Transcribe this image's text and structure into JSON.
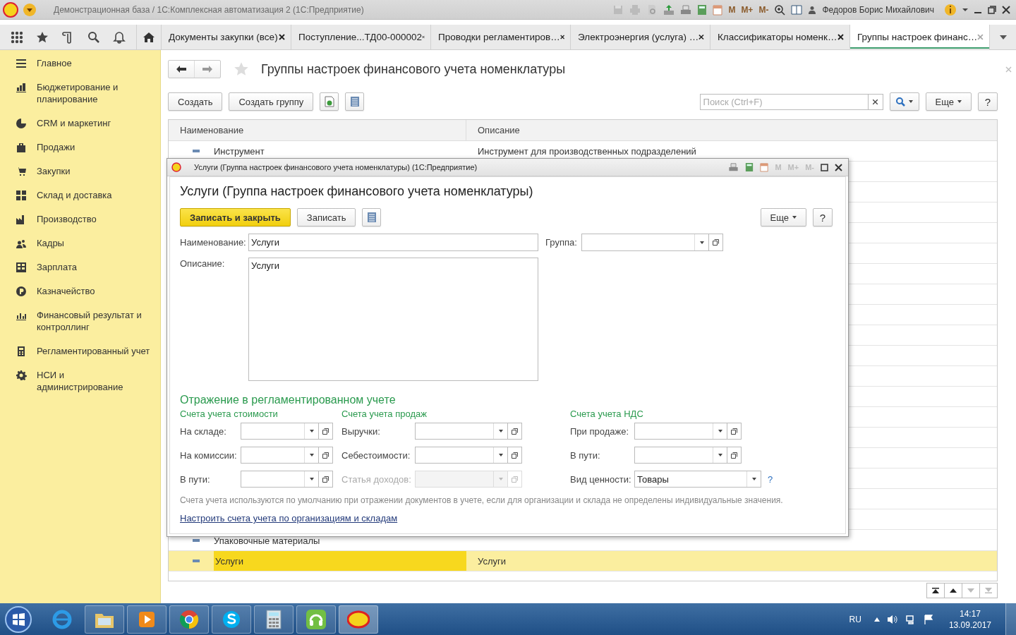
{
  "window": {
    "title": "Демонстрационная база / 1С:Комплексная автоматизация 2  (1С:Предприятие)",
    "memory_buttons": [
      "M",
      "M+",
      "M-"
    ],
    "user": "Федоров Борис Михайлович"
  },
  "tabs": [
    {
      "label": "Документы закупки (все)",
      "selected": false
    },
    {
      "label": "Поступление...ТД00-000002",
      "selected": false
    },
    {
      "label": "Проводки регламентиров…",
      "selected": false
    },
    {
      "label": "Электроэнергия (услуга) …",
      "selected": false
    },
    {
      "label": "Классификаторы номенк…",
      "selected": false
    },
    {
      "label": "Группы настроек финанс…",
      "selected": true
    }
  ],
  "sidebar": {
    "items": [
      "Главное",
      "Бюджетирование и планирование",
      "CRM и маркетинг",
      "Продажи",
      "Закупки",
      "Склад и доставка",
      "Производство",
      "Кадры",
      "Зарплата",
      "Казначейство",
      "Финансовый результат и контроллинг",
      "Регламентированный учет",
      "НСИ и администрирование"
    ]
  },
  "page": {
    "title": "Группы настроек финансового учета номенклатуры",
    "buttons": [
      "Создать",
      "Создать группу"
    ],
    "search": {
      "placeholder": "Поиск (Ctrl+F)"
    },
    "more": "Еще",
    "help": "?"
  },
  "table": {
    "columns": [
      "Наименование",
      "Описание"
    ],
    "rows": [
      {
        "name": "Инструмент",
        "description": "Инструмент для производственных подразделений",
        "selected": false
      },
      {
        "name": "Упаковочные материалы",
        "description": "",
        "selected": false
      },
      {
        "name": "Услуги",
        "description": "Услуги",
        "selected": true
      }
    ]
  },
  "dialog": {
    "window_title": "Услуги (Группа настроек финансового учета номенклатуры)  (1С:Предприятие)",
    "memory_buttons": [
      "M",
      "M+",
      "M-"
    ],
    "heading": "Услуги (Группа настроек финансового учета номенклатуры)",
    "primary_button": "Записать и закрыть",
    "save_button": "Записать",
    "more": "Еще",
    "help": "?",
    "name_label": "Наименование:",
    "name_value": "Услуги",
    "group_label": "Группа:",
    "description_label": "Описание:",
    "description_value": "Услуги",
    "section_title": "Отражение в регламентированном учете",
    "columns": [
      {
        "header": "Счета учета стоимости",
        "fields": [
          {
            "label": "На складе:",
            "disabled": false
          },
          {
            "label": "На комиссии:",
            "disabled": false
          },
          {
            "label": "В пути:",
            "disabled": false
          }
        ]
      },
      {
        "header": "Счета учета продаж",
        "fields": [
          {
            "label": "Выручки:",
            "disabled": false
          },
          {
            "label": "Себестоимости:",
            "disabled": false
          },
          {
            "label": "Статья доходов:",
            "disabled": true
          }
        ]
      },
      {
        "header": "Счета учета НДС",
        "fields": [
          {
            "label": "При продаже:",
            "disabled": false
          },
          {
            "label": "В пути:",
            "disabled": false
          },
          {
            "label": "Вид ценности:",
            "value": "Товары",
            "help": "?",
            "disabled": false
          }
        ]
      }
    ],
    "note": "Счета учета используются по умолчанию при отражении документов в учете, если для организации и склада не определены индивидуальные значения.",
    "link": "Настроить счета учета по организациям и складам"
  },
  "taskbar": {
    "language": "RU",
    "time": "14:17",
    "date": "13.09.2017"
  }
}
